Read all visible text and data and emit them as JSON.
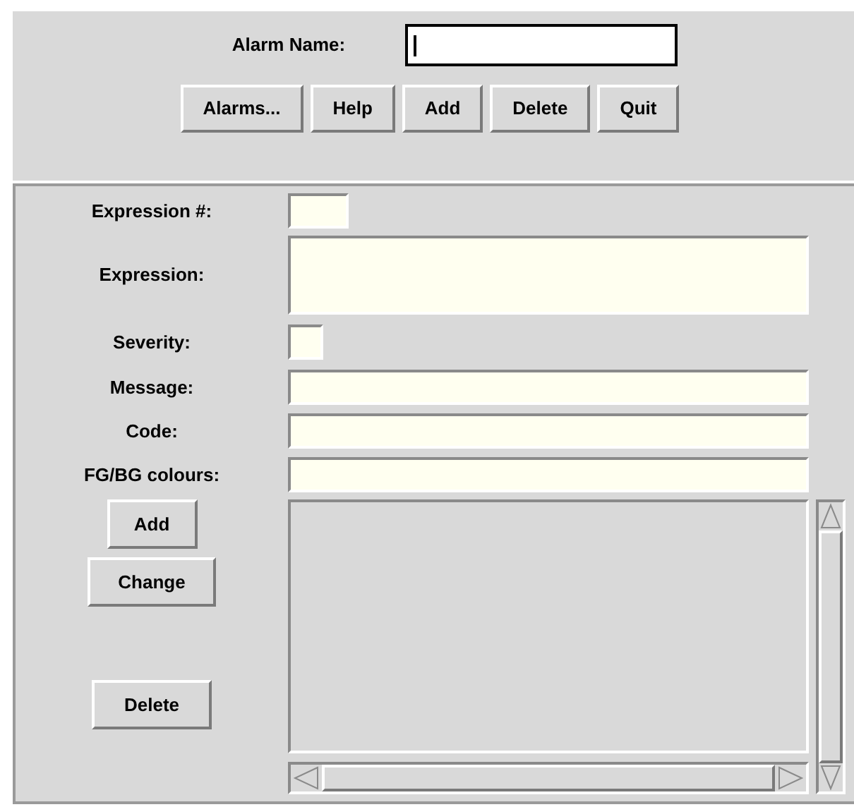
{
  "header": {
    "label": "Alarm Name:",
    "buttons": [
      "Alarms...",
      "Help",
      "Add",
      "Delete",
      "Quit"
    ]
  },
  "form": {
    "fields": [
      {
        "label": "Expression #:",
        "kind": "number"
      },
      {
        "label": "Expression:",
        "kind": "multiline"
      },
      {
        "label": "Severity:",
        "kind": "digit"
      },
      {
        "label": "Message:",
        "kind": "line"
      },
      {
        "label": "Code:",
        "kind": "line"
      },
      {
        "label": "FG/BG colours:",
        "kind": "line"
      }
    ],
    "buttons": [
      "Add",
      "Change",
      "Delete"
    ]
  }
}
